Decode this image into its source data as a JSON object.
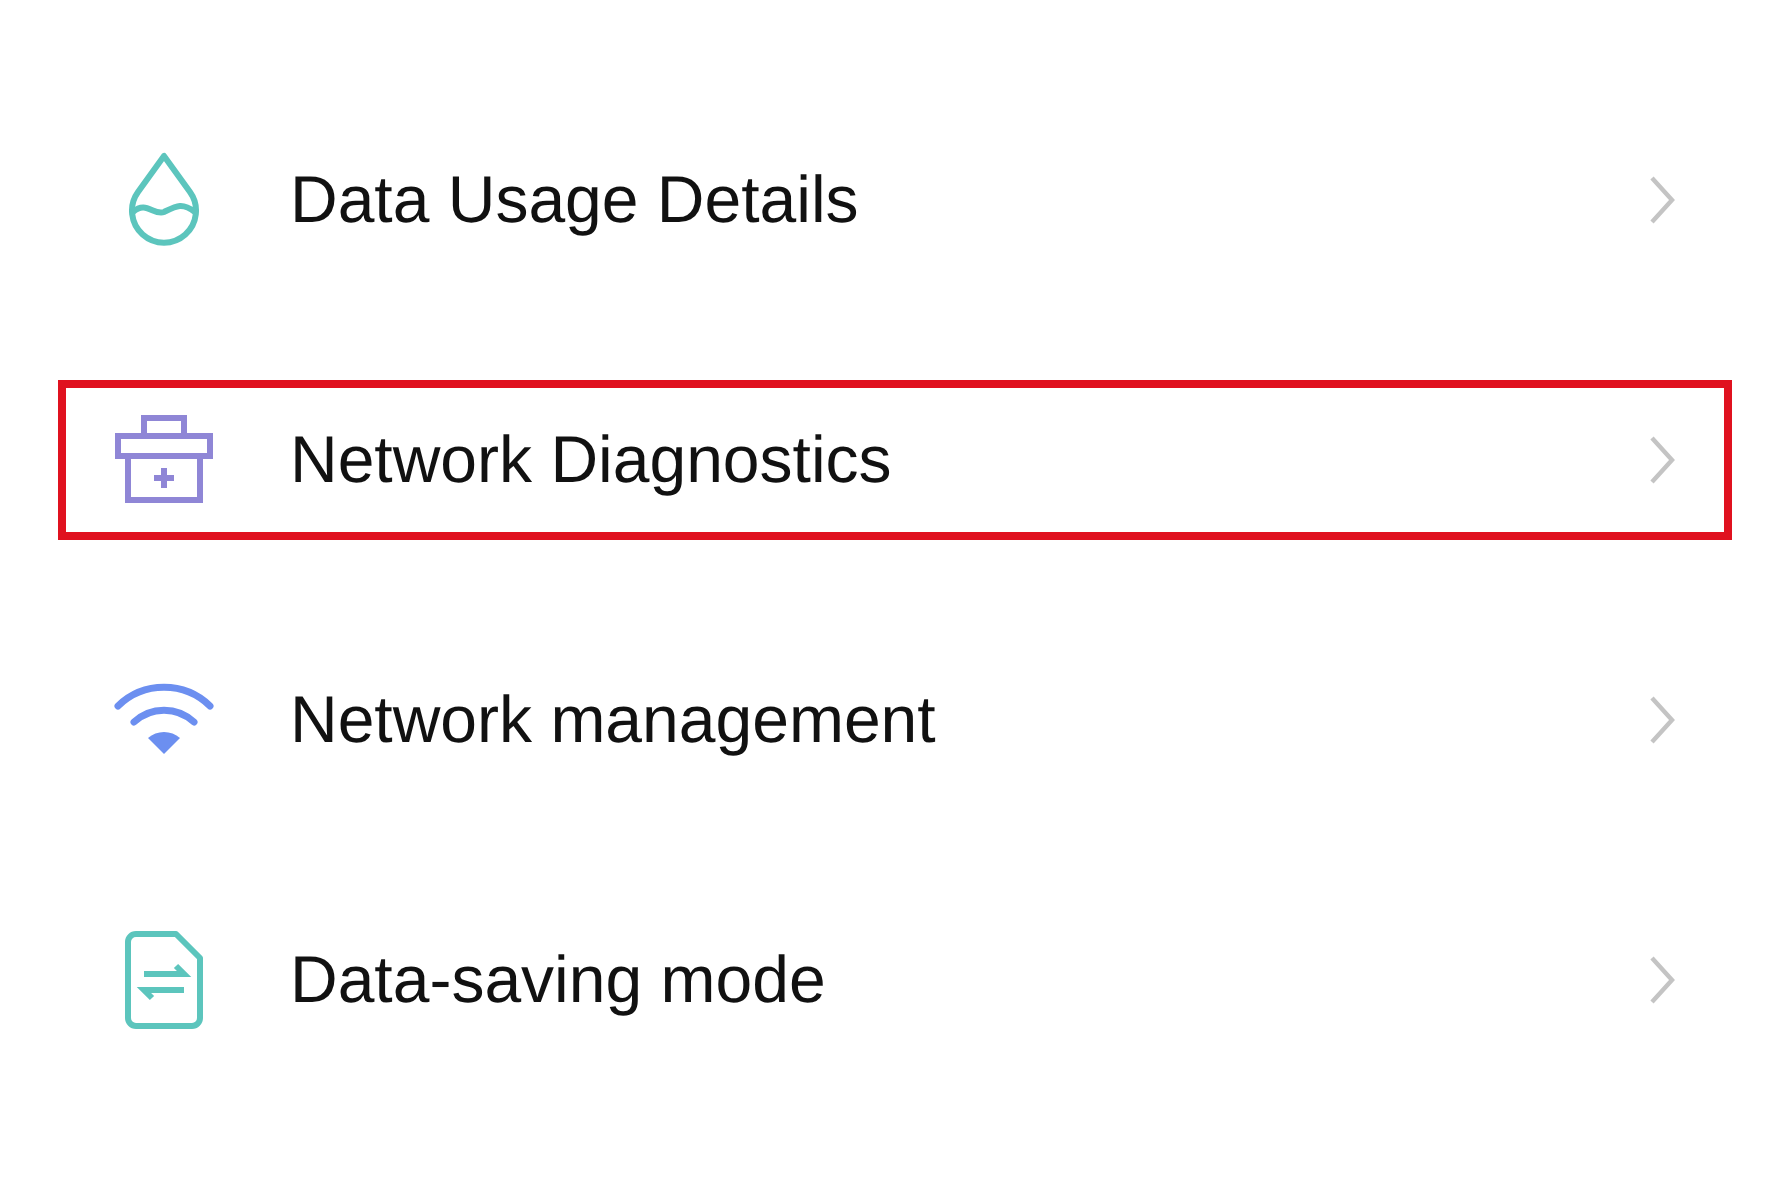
{
  "items": [
    {
      "label": "Data Usage Details",
      "highlighted": false
    },
    {
      "label": "Network Diagnostics",
      "highlighted": true
    },
    {
      "label": "Network management",
      "highlighted": false
    },
    {
      "label": "Data-saving mode",
      "highlighted": false
    }
  ]
}
